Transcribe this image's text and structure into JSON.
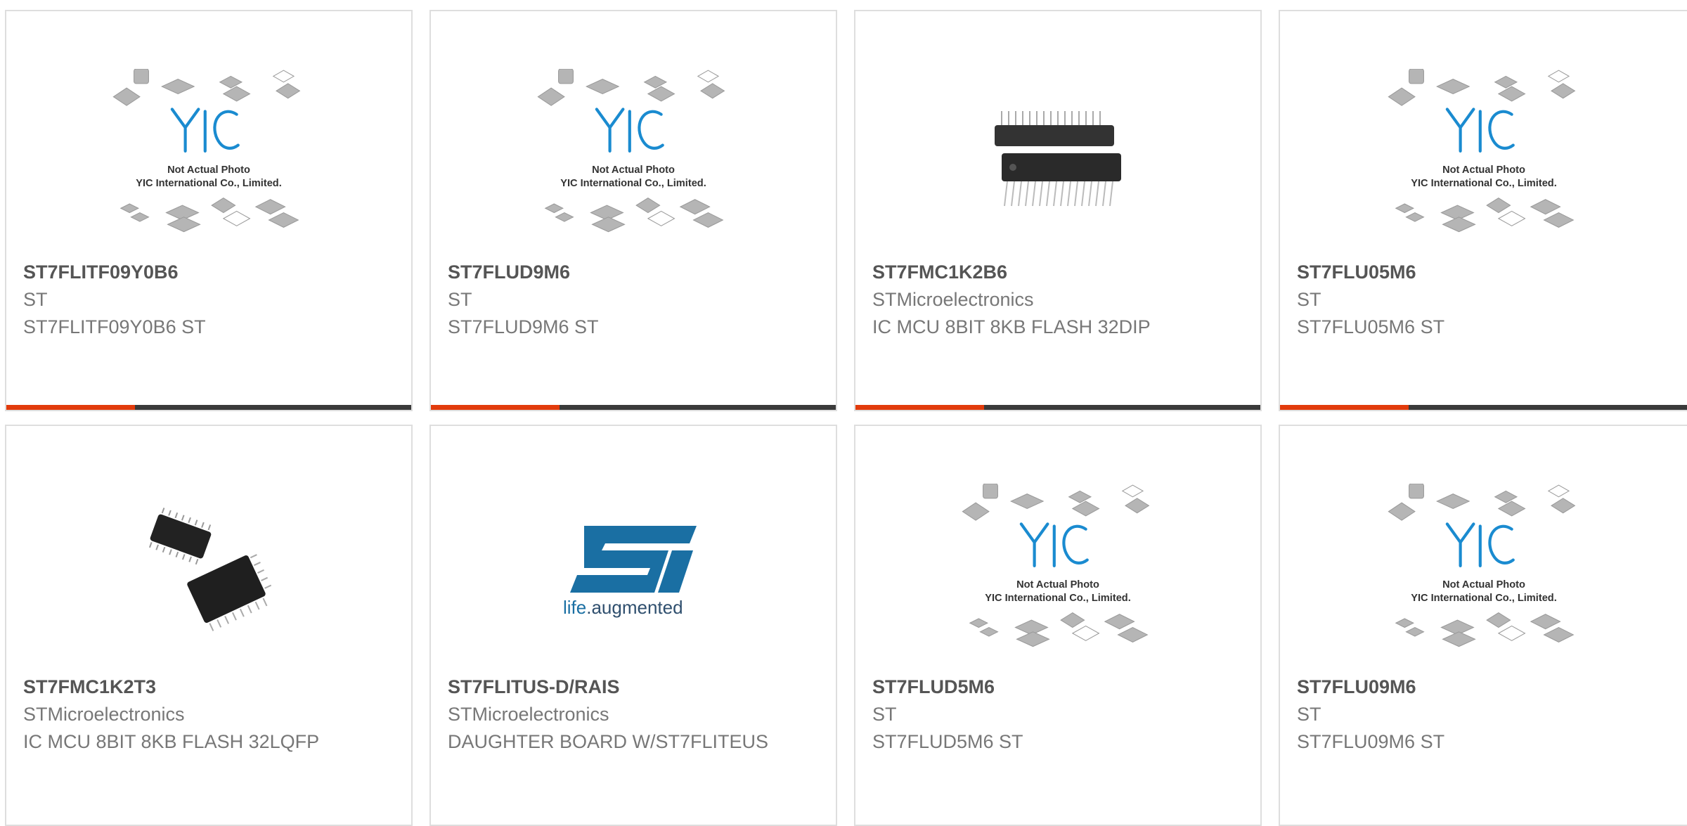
{
  "colors": {
    "accent": "#e23b0c",
    "bar": "#3a3a3a",
    "st_logo": "#1a6fa3"
  },
  "placeholder": {
    "line1": "Not Actual Photo",
    "line2": "YIC International Co., Limited.",
    "logo_text": "YIC"
  },
  "st_logo": {
    "mark": "ST",
    "tagline_life": "life",
    "tagline_rest": ".augmented"
  },
  "products": [
    {
      "part": "ST7FLITF09Y0B6",
      "brand": "ST",
      "desc": "ST7FLITF09Y0B6 ST",
      "image": "placeholder-icon"
    },
    {
      "part": "ST7FLUD9M6",
      "brand": "ST",
      "desc": "ST7FLUD9M6 ST",
      "image": "placeholder-icon"
    },
    {
      "part": "ST7FMC1K2B6",
      "brand": "STMicroelectronics",
      "desc": "IC MCU 8BIT 8KB FLASH 32DIP",
      "image": "dip-chip-icon"
    },
    {
      "part": "ST7FLU05M6",
      "brand": "ST",
      "desc": "ST7FLU05M6 ST",
      "image": "placeholder-icon"
    },
    {
      "part": "ST7FMC1K2T3",
      "brand": "STMicroelectronics",
      "desc": "IC MCU 8BIT 8KB FLASH 32LQFP",
      "image": "lqfp-chip-icon"
    },
    {
      "part": "ST7FLITUS-D/RAIS",
      "brand": "STMicroelectronics",
      "desc": "DAUGHTER BOARD W/ST7FLITEUS",
      "image": "st-logo-icon"
    },
    {
      "part": "ST7FLUD5M6",
      "brand": "ST",
      "desc": "ST7FLUD5M6 ST",
      "image": "placeholder-icon"
    },
    {
      "part": "ST7FLU09M6",
      "brand": "ST",
      "desc": "ST7FLU09M6 ST",
      "image": "placeholder-icon"
    }
  ]
}
